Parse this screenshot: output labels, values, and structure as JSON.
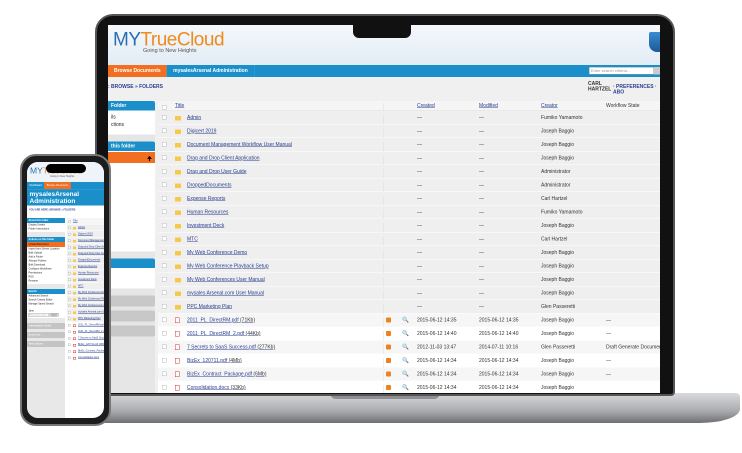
{
  "laptop": {
    "logo": {
      "my": "MY",
      "true": "True",
      "cloud": "Cloud",
      "tagline": "Going to New Heights"
    },
    "nav": {
      "tabs": [
        "Browse Documents",
        "mysalesArsenal Administration"
      ],
      "search_placeholder": "Enter search criteria..."
    },
    "breadcrumb": ": BROWSE » FOLDERS",
    "user": {
      "name": "CARL HARTZEL",
      "links": "· PREFERENCES · ABO"
    },
    "sidebar": {
      "box1_title": "Folder",
      "box1_items": [
        "ils",
        "ctions"
      ],
      "box2_title": "this folder"
    },
    "table": {
      "headers": {
        "title": "Title",
        "created": "Created",
        "modified": "Modified",
        "creator": "Creator",
        "workflow": "Workflow State"
      },
      "folders": [
        {
          "title": "Admin",
          "created": "—",
          "modified": "—",
          "creator": "Fumiko Yamamoto"
        },
        {
          "title": "Digicert 2019",
          "created": "—",
          "modified": "—",
          "creator": "Joseph Baggio"
        },
        {
          "title": "Document Management Workflow User Manual",
          "created": "—",
          "modified": "—",
          "creator": "Joseph Baggio"
        },
        {
          "title": "Drag and Drop Client Application",
          "created": "—",
          "modified": "—",
          "creator": "Joseph Baggio"
        },
        {
          "title": "Drag and Drop User Guide",
          "created": "—",
          "modified": "—",
          "creator": "Administrator"
        },
        {
          "title": "DroppedDocuments",
          "created": "—",
          "modified": "—",
          "creator": "Administrator"
        },
        {
          "title": "Expense Reports",
          "created": "—",
          "modified": "—",
          "creator": "Carl Hartzel"
        },
        {
          "title": "Human Resources",
          "created": "—",
          "modified": "—",
          "creator": "Fumiko Yamamoto"
        },
        {
          "title": "Investment Deck",
          "created": "—",
          "modified": "—",
          "creator": "Joseph Baggio"
        },
        {
          "title": "MTC",
          "created": "—",
          "modified": "—",
          "creator": "Carl Hartzel"
        },
        {
          "title": "My Web Conference Demo",
          "created": "—",
          "modified": "—",
          "creator": "Joseph Baggio"
        },
        {
          "title": "My Web Conference Playback Setup",
          "created": "—",
          "modified": "—",
          "creator": "Joseph Baggio"
        },
        {
          "title": "My Web Conferences User Manual",
          "created": "—",
          "modified": "—",
          "creator": "Joseph Baggio"
        },
        {
          "title": "mysales Arsenal.com User Manual",
          "created": "—",
          "modified": "—",
          "creator": "Joseph Baggio"
        },
        {
          "title": "PPC Marketing Plan",
          "created": "—",
          "modified": "—",
          "creator": "Glen Passeretti"
        }
      ],
      "files": [
        {
          "title": "2011_PL_DirectRM.pdf",
          "size": "(71Kb)",
          "created": "2015-06-12 14:35",
          "modified": "2015-06-12 14:35",
          "creator": "Joseph Baggio",
          "workflow": "—"
        },
        {
          "title": "2011_PL_DirectRM_2.pdf",
          "size": "(44Kb)",
          "created": "2015-06-12 14:40",
          "modified": "2015-06-12 14:40",
          "creator": "Joseph Baggio",
          "workflow": "—"
        },
        {
          "title": "7 Secrets to SaaS Success.pdf",
          "size": "(277Kb)",
          "created": "2012-11-03 13:47",
          "modified": "2014-07-11 10:16",
          "creator": "Glen Passeretti",
          "workflow": "Draft Generate Document"
        },
        {
          "title": "BizEx_120711.pdf",
          "size": "(4Mb)",
          "created": "2015-06-12 14:34",
          "modified": "2015-06-12 14:34",
          "creator": "Joseph Baggio",
          "workflow": "—"
        },
        {
          "title": "BizEx_Contract_Package.pdf",
          "size": "(6Mb)",
          "created": "2015-06-12 14:34",
          "modified": "2015-06-12 14:34",
          "creator": "Joseph Baggio",
          "workflow": "—"
        },
        {
          "title": "Consolidation.docx",
          "size": "(33Kb)",
          "created": "2015-06-12 14:34",
          "modified": "2015-06-12 14:34",
          "creator": "Joseph Baggio",
          "workflow": ""
        }
      ]
    }
  },
  "phone": {
    "logo": {
      "my": "MY",
      "true": "True",
      "cloud": "Cloud",
      "tagline": "Going to New Heights"
    },
    "nav": [
      "Dashboard",
      "Browse Documents",
      "mysalesArsenal Administration"
    ],
    "breadcrumb": "YOU ARE HERE: BROWSE » FOLDERS",
    "about": {
      "title": "About this folder",
      "items": [
        "Display Details",
        "Folder Instructions"
      ]
    },
    "actions": {
      "title": "Actions on this folder",
      "upload": "Upload Document",
      "items": [
        "Import from Server Location",
        "Bulk Upload",
        "Add a Folder",
        "Allocate Folders",
        "Bulk Download",
        "Configure Workflows",
        "Permissions",
        "RSS",
        "Rename"
      ]
    },
    "search": {
      "title": "Search",
      "items": [
        "Advanced Search",
        "Search Criteria Editor",
        "Manage Saved Search"
      ],
      "label": "Jane",
      "placeholder": "Enter search criteria",
      "button": "search"
    },
    "bottom": [
      "Administration Mode",
      "Browse by...",
      "View Options"
    ],
    "table": {
      "header": "Title",
      "rows": [
        {
          "t": "Admin",
          "f": true
        },
        {
          "t": "Digicert 2019",
          "f": true
        },
        {
          "t": "Document Management Wor",
          "f": true
        },
        {
          "t": "Drag and Drop Client Applic",
          "f": true
        },
        {
          "t": "Drag and Drop User Guide",
          "f": true
        },
        {
          "t": "DroppedDocuments",
          "f": true
        },
        {
          "t": "Expense Reports",
          "f": true
        },
        {
          "t": "Human Resources",
          "f": true
        },
        {
          "t": "Investment Deck",
          "f": true
        },
        {
          "t": "MTC",
          "f": true
        },
        {
          "t": "My Web Conference Demo",
          "f": true
        },
        {
          "t": "My Web Conference Playback",
          "f": true
        },
        {
          "t": "My Web Conferences User Ma",
          "f": true
        },
        {
          "t": "mysales Arsenal.com User M",
          "f": true
        },
        {
          "t": "PPC Marketing Plan",
          "f": true
        },
        {
          "t": "2011_PL_DirectRM.pdf (71K",
          "f": false
        },
        {
          "t": "2011_PL_DirectRM_2.pdf (4",
          "f": false
        },
        {
          "t": "7 Secrets to SaaS Success",
          "f": false
        },
        {
          "t": "BizEx_120711.pdf (4Mb)",
          "f": false
        },
        {
          "t": "BizEx_Contract_Package.pd",
          "f": false
        },
        {
          "t": "Consolidation.docx",
          "f": false
        }
      ]
    }
  }
}
